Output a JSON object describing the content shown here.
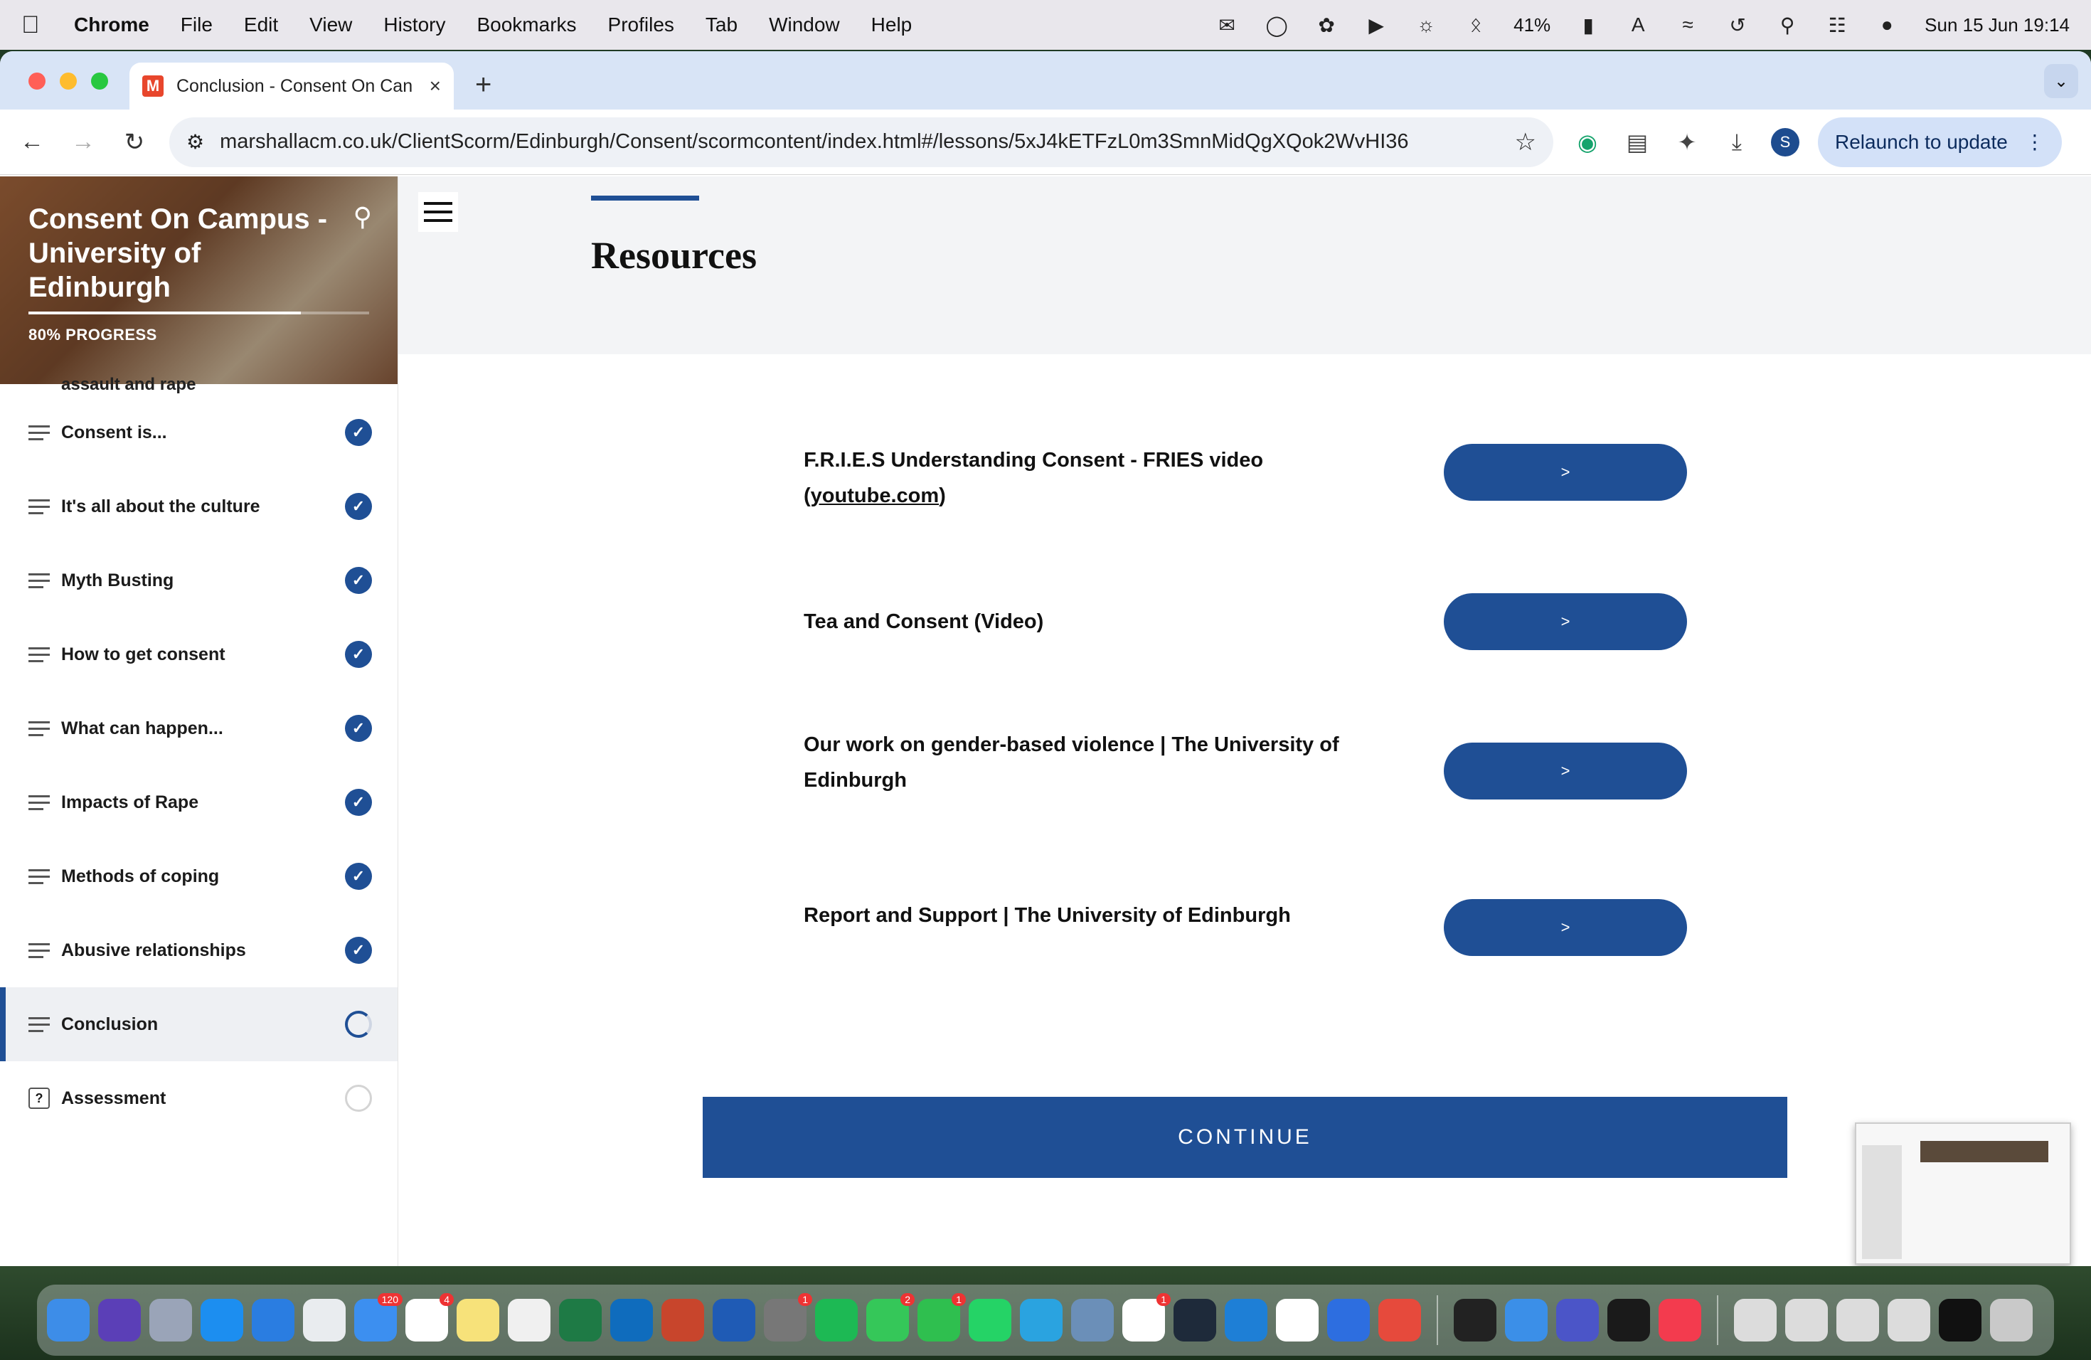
{
  "menubar": {
    "app_name": "Chrome",
    "items": [
      "File",
      "Edit",
      "View",
      "History",
      "Bookmarks",
      "Profiles",
      "Tab",
      "Window",
      "Help"
    ],
    "battery": "41%",
    "clock": "Sun 15 Jun  19:14"
  },
  "browser": {
    "tab_title": "Conclusion - Consent On Can",
    "url": "marshallacm.co.uk/ClientScorm/Edinburgh/Consent/scormcontent/index.html#/lessons/5xJ4kETFzL0m3SmnMidQgXQok2WvHI36",
    "relaunch_label": "Relaunch to update",
    "profile_initial": "S"
  },
  "course": {
    "title": "Consent On Campus - University of Edinburgh",
    "progress_label": "80% PROGRESS",
    "progress_value": 0.8,
    "partial_item": "assault and rape",
    "lessons": [
      {
        "label": "Consent is...",
        "status": "complete"
      },
      {
        "label": "It's all about the culture",
        "status": "complete"
      },
      {
        "label": "Myth Busting",
        "status": "complete"
      },
      {
        "label": "How to get consent",
        "status": "complete"
      },
      {
        "label": "What can happen...",
        "status": "complete"
      },
      {
        "label": "Impacts of Rape",
        "status": "complete"
      },
      {
        "label": "Methods of coping",
        "status": "complete"
      },
      {
        "label": "Abusive relationships",
        "status": "complete"
      },
      {
        "label": "Conclusion",
        "status": "in-progress"
      },
      {
        "label": "Assessment",
        "status": "not-started"
      }
    ]
  },
  "page": {
    "title": "Resources",
    "resources": [
      {
        "text": "F.R.I.E.S Understanding Consent - FRIES video",
        "link": "youtube.com",
        "button": ">"
      },
      {
        "text": "Tea and Consent (Video)",
        "button": ">"
      },
      {
        "text": "Our work on gender-based violence | The University of Edinburgh",
        "button": ">"
      },
      {
        "text": "Report and Support | The University of Edinburgh",
        "button": ">"
      }
    ],
    "continue_label": "CONTINUE"
  },
  "colors": {
    "primary": "#1f4f95",
    "sidebar_active": "#eef0f3"
  }
}
